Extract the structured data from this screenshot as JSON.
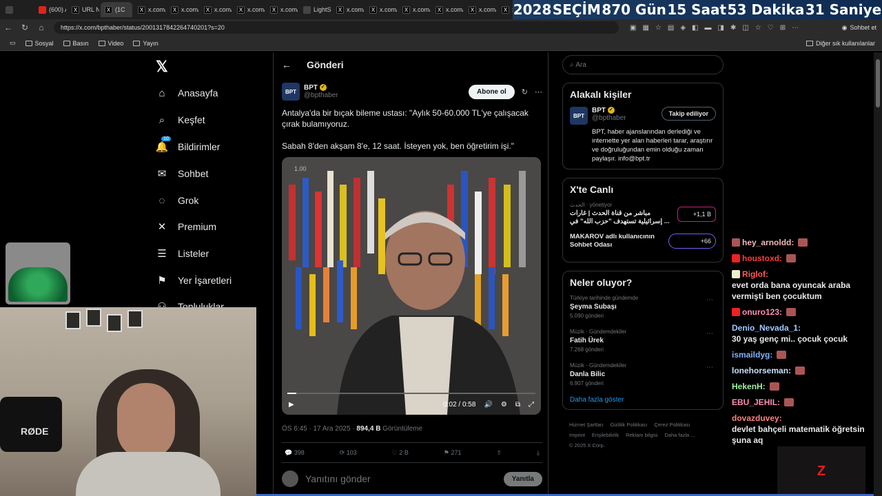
{
  "browser": {
    "tabs": [
      {
        "label": "",
        "type": "blank"
      },
      {
        "label": "(600) A",
        "type": "yt"
      },
      {
        "label": "URL N",
        "type": "x"
      },
      {
        "label": "(1C",
        "type": "x",
        "active": true
      },
      {
        "label": "x.com/",
        "type": "x"
      },
      {
        "label": "x.com/",
        "type": "x"
      },
      {
        "label": "x.com/",
        "type": "x"
      },
      {
        "label": "x.com/",
        "type": "x"
      },
      {
        "label": "x.com/",
        "type": "x"
      },
      {
        "label": "LightS",
        "type": "other"
      },
      {
        "label": "x.com/",
        "type": "x"
      },
      {
        "label": "x.com/",
        "type": "x"
      },
      {
        "label": "x.com/",
        "type": "x"
      },
      {
        "label": "x.com/",
        "type": "x"
      },
      {
        "label": "x.com/",
        "type": "x"
      },
      {
        "label": "xa",
        "type": "x"
      }
    ],
    "url": "https://x.com/bpthaber/status/2001317842264740201?s=20",
    "sohbet_label": "Sohbet et",
    "bookmarks": [
      "Sosyal",
      "Basın",
      "Video",
      "Yayın"
    ],
    "bookmarks_right": "Diğer sık kullanılanlar"
  },
  "countdown": {
    "year": "2028",
    "label": "SEÇİM",
    "days": "870 Gün",
    "hours": "15 Saat",
    "minutes": "53 Dakika",
    "seconds": "31 Saniye"
  },
  "nav": {
    "items": [
      {
        "label": "Anasayfa",
        "icon": "⌂",
        "name": "home"
      },
      {
        "label": "Keşfet",
        "icon": "⌕",
        "name": "explore"
      },
      {
        "label": "Bildirimler",
        "icon": "🔔",
        "name": "notifications",
        "badge": "10"
      },
      {
        "label": "Sohbet",
        "icon": "✉",
        "name": "chat"
      },
      {
        "label": "Grok",
        "icon": "◌",
        "name": "grok"
      },
      {
        "label": "Premium",
        "icon": "✕",
        "name": "premium"
      },
      {
        "label": "Listeler",
        "icon": "☰",
        "name": "lists"
      },
      {
        "label": "Yer İşaretleri",
        "icon": "⚑",
        "name": "bookmarks"
      },
      {
        "label": "Topluluklar",
        "icon": "⚇",
        "name": "communities"
      }
    ]
  },
  "post": {
    "header": "Gönderi",
    "author": "BPT",
    "handle": "@bpthaber",
    "subscribe": "Abone ol",
    "text1": "Antalya'da bir bıçak bileme ustası: \"Aylık 50-60.000 TL'ye çalışacak çırak bulamıyoruz.",
    "text2": "Sabah 8'den akşam 8'e, 12 saat. İsteyen yok, ben öğretirim işi.\"",
    "video_tag": "1.00",
    "video_time": "0:02 / 0:58",
    "video_progress": 0.035,
    "meta_time": "ÖS 6:45 · 17 Ara 2025 · ",
    "views": "894,4 B",
    "views_label": " Görüntüleme",
    "replies": "398",
    "reposts": "103",
    "likes": "2 B",
    "bookmarks": "271",
    "reply_placeholder": "Yanıtını gönder",
    "reply_button": "Yanıtla"
  },
  "right": {
    "search_placeholder": "Ara",
    "related_title": "Alakalı kişiler",
    "related": {
      "name": "BPT",
      "handle": "@bpthaber",
      "button": "Takip ediliyor",
      "bio": "BPT, haber ajanslarından derlediği ve internette yer alan haberleri tarar, araştırır ve doğruluğundan emin olduğu zaman paylaşır. info@bpt.tr"
    },
    "live_title": "X'te Canlı",
    "live": [
      {
        "sub": "الحدث · yönetiyor",
        "title": "مباشر من قناة الحدث | غارات إسرائيلية تستهدف \"حزب الله\" في ...",
        "count": "+1,1 B"
      },
      {
        "sub": "",
        "title": "MAKAROV adlı kullanıcının Sohbet Odası",
        "count": "+66"
      }
    ],
    "trends_title": "Neler oluyor?",
    "trends": [
      {
        "cat": "Türkiye tarihinde gündemde",
        "title": "Şeyma Subaşı",
        "count": "5.090 gönderi"
      },
      {
        "cat": "Müzik · Gündemdekiler",
        "title": "Fatih Ürek",
        "count": "7.268 gönderi"
      },
      {
        "cat": "Müzik · Gündemdekiler",
        "title": "Danla Bilic",
        "count": "6.907 gönderi"
      }
    ],
    "show_more": "Daha fazla göster",
    "footer": [
      "Hizmet Şartları",
      "Gizlilik Politikası",
      "Çerez Politikası",
      "Imprint",
      "Erişilebilirlik",
      "Reklam bilgisi",
      "Daha fazla ...",
      "© 2025 X Corp."
    ]
  },
  "chat": [
    {
      "user": "hey_arnoldd:",
      "color": "#f0b8b8",
      "text": ""
    },
    {
      "user": "houstoxd:",
      "color": "#ff3b3b",
      "text": ""
    },
    {
      "user": "Riglof:",
      "color": "#ff5a5a",
      "text": "evet orda bana oyuncak araba vermişti ben çocuktum"
    },
    {
      "user": "onuro123:",
      "color": "#ff8fb0",
      "text": ""
    },
    {
      "user": "Denio_Nevada_1:",
      "color": "#a0c8ff",
      "text": "30 yaş genç mi.. çocuk çocuk"
    },
    {
      "user": "ismaildyg:",
      "color": "#7fb2ff",
      "text": ""
    },
    {
      "user": "lonehorseman:",
      "color": "#c8e0ff",
      "text": ""
    },
    {
      "user": "HekenH:",
      "color": "#9ff0a0",
      "text": ""
    },
    {
      "user": "EBU_JEHIL:",
      "color": "#ff8fb0",
      "text": ""
    },
    {
      "user": "dovazduvey:",
      "color": "#ff8080",
      "text": "devlet bahçeli matematik öğretsin şuna aq"
    }
  ],
  "webcam_mic_label": "RØDE"
}
